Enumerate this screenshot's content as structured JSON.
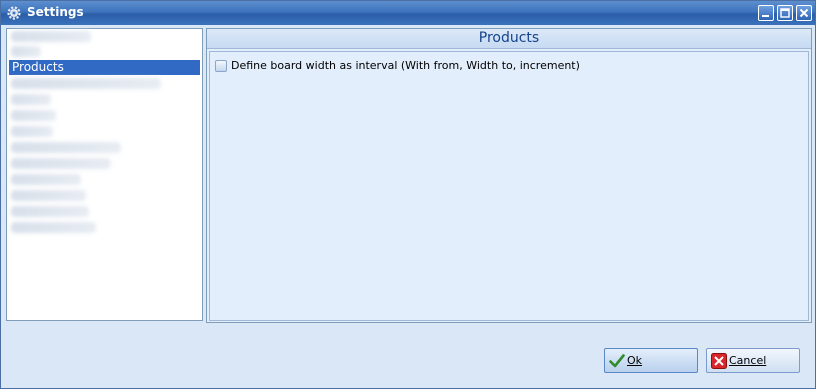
{
  "window": {
    "title": "Settings",
    "icon": "gear-icon",
    "controls": [
      "minimize-icon",
      "maximize-icon",
      "close-icon"
    ]
  },
  "sidebar": {
    "selected_item": "Products",
    "redacted_item_count": 14
  },
  "panel": {
    "title": "Products",
    "checkbox": {
      "label": "Define board width as interval (With from, Width to, increment)",
      "checked": false
    }
  },
  "footer": {
    "ok_label": "Ok",
    "cancel_label": "Cancel"
  },
  "colors": {
    "titlebar": "#3d74bd",
    "selection": "#316ac5",
    "panel_bg": "#e2eefb",
    "header_text": "#15428b"
  }
}
